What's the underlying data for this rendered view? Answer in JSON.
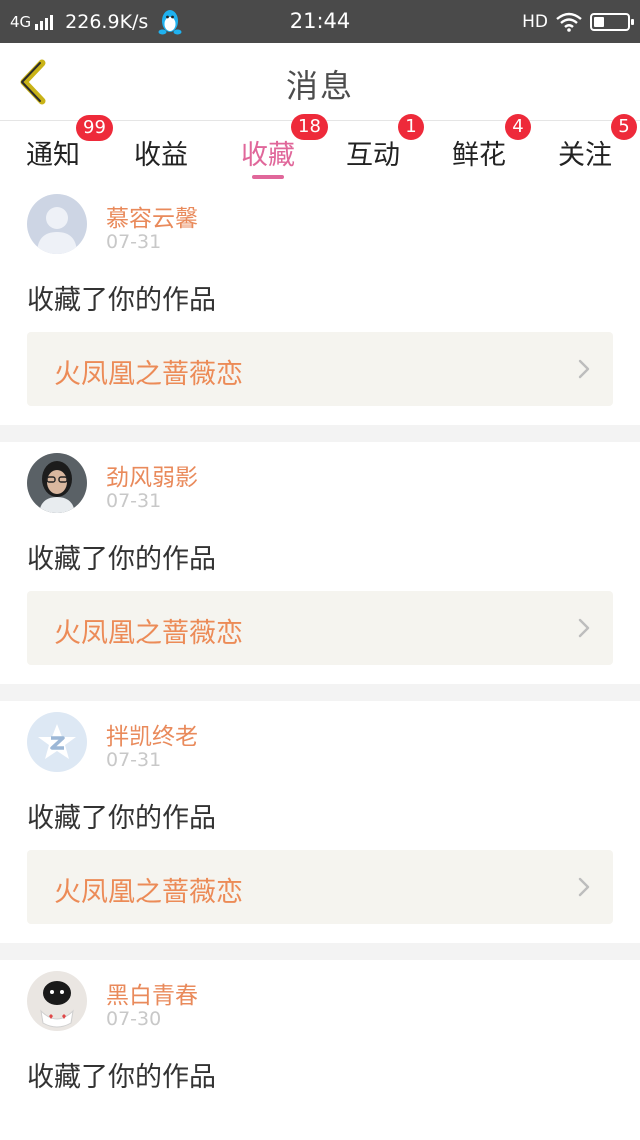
{
  "status_bar": {
    "network": "4G",
    "speed": "226.9K/s",
    "time": "21:44",
    "hd": "HD",
    "battery_level": 0.3
  },
  "header": {
    "title": "消息",
    "back_icon": "chevron-left-icon"
  },
  "tabs": [
    {
      "label": "通知",
      "badge": "99"
    },
    {
      "label": "收益",
      "badge": ""
    },
    {
      "label": "收藏",
      "badge": "18",
      "active": true
    },
    {
      "label": "互动",
      "badge": "1"
    },
    {
      "label": "鲜花",
      "badge": "4"
    },
    {
      "label": "关注",
      "badge": "5"
    }
  ],
  "feed": [
    {
      "name": "慕容云馨",
      "date": "07-31",
      "message": "收藏了你的作品",
      "work": "火凤凰之蔷薇恋",
      "avatar": "default-avatar"
    },
    {
      "name": "劲风弱影",
      "date": "07-31",
      "message": "收藏了你的作品",
      "work": "火凤凰之蔷薇恋",
      "avatar": "photo-avatar"
    },
    {
      "name": "拌凯终老",
      "date": "07-31",
      "message": "收藏了你的作品",
      "work": "火凤凰之蔷薇恋",
      "avatar": "qzone-avatar"
    },
    {
      "name": "黑白青春",
      "date": "07-30",
      "message": "收藏了你的作品",
      "work": "",
      "avatar": "cat-avatar"
    }
  ],
  "colors": {
    "accent": "#e0679a",
    "badge": "#ee2a3a",
    "name": "#e98a5b",
    "work_title": "#ec8b57",
    "back_icon": "#c9b317"
  }
}
